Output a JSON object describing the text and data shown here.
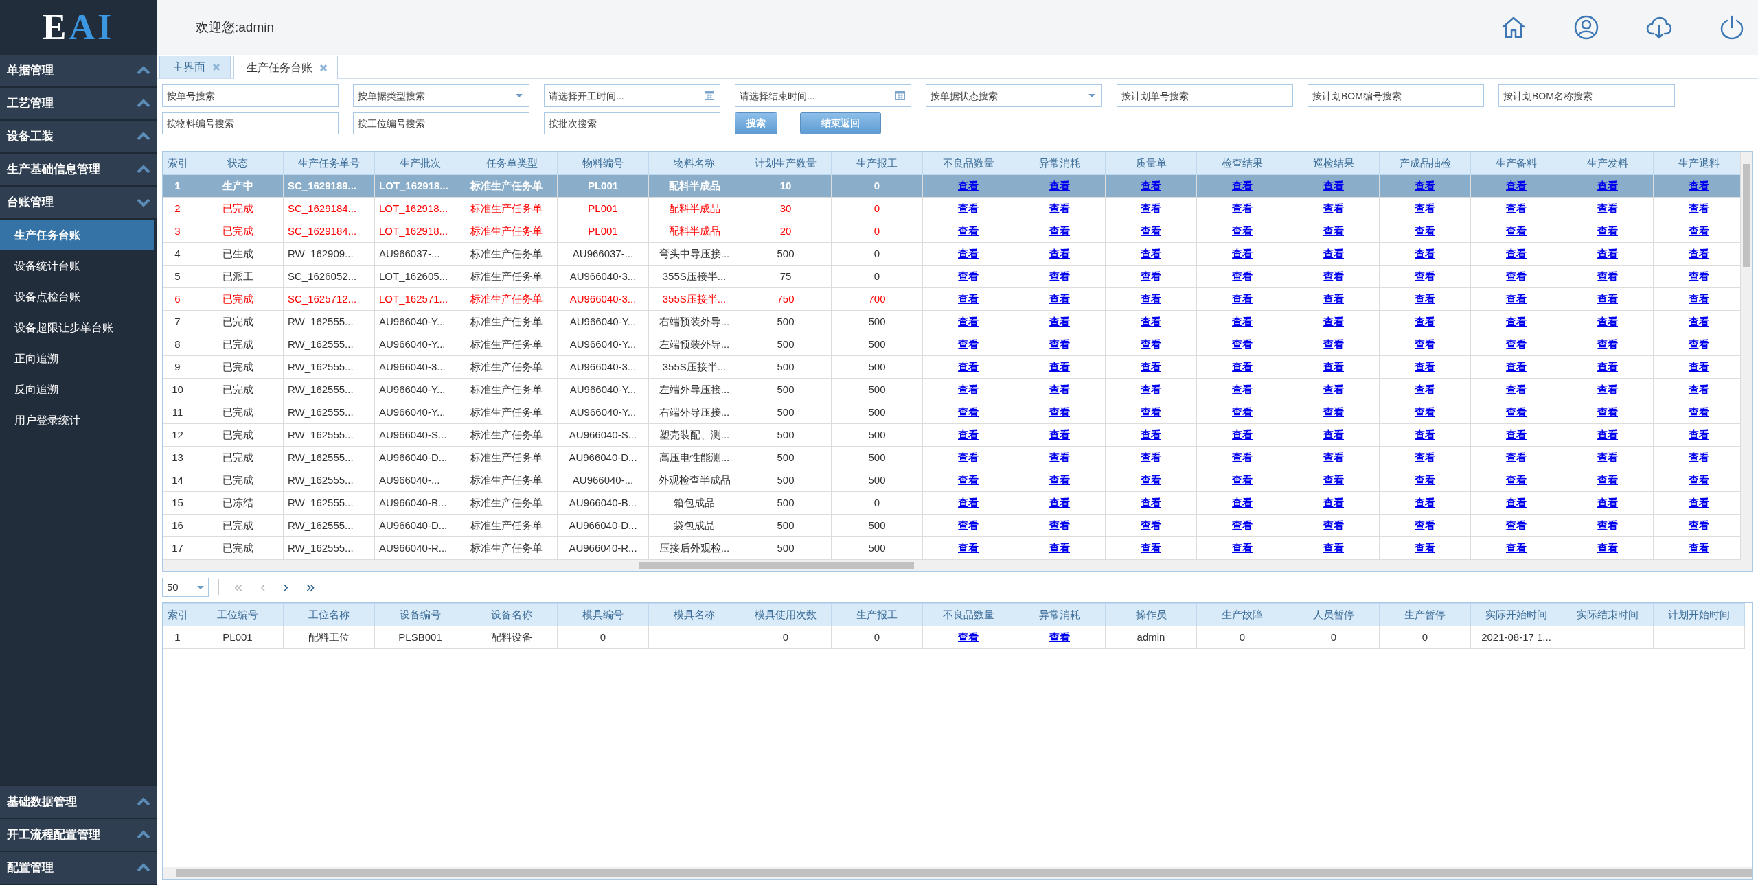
{
  "sidebar": {
    "logo": [
      {
        "text": "E",
        "color": "#ffffff"
      },
      {
        "text": "AI",
        "color": "#3c97e0"
      }
    ],
    "groups": [
      {
        "label": "单据管理",
        "expanded": false
      },
      {
        "label": "工艺管理",
        "expanded": false
      },
      {
        "label": "设备工装",
        "expanded": false
      },
      {
        "label": "生产基础信息管理",
        "expanded": false
      },
      {
        "label": "台账管理",
        "expanded": true,
        "children": [
          {
            "label": "生产任务台账",
            "selected": true
          },
          {
            "label": "设备统计台账",
            "selected": false
          },
          {
            "label": "设备点检台账",
            "selected": false
          },
          {
            "label": "设备超限让步单台账",
            "selected": false
          },
          {
            "label": "正向追溯",
            "selected": false
          },
          {
            "label": "反向追溯",
            "selected": false
          },
          {
            "label": "用户登录统计",
            "selected": false
          }
        ]
      }
    ],
    "bottom_groups": [
      {
        "label": "基础数据管理",
        "expanded": false
      },
      {
        "label": "开工流程配置管理",
        "expanded": false
      },
      {
        "label": "配置管理",
        "expanded": false
      }
    ]
  },
  "header": {
    "welcome": "欢迎您:admin"
  },
  "tabs": [
    {
      "label": "主界面",
      "selected": false
    },
    {
      "label": "生产任务台账",
      "selected": true
    }
  ],
  "filters": [
    [
      {
        "kind": "text",
        "placeholder": "按单号搜索"
      },
      {
        "kind": "select",
        "placeholder": "按单据类型搜索"
      },
      {
        "kind": "date",
        "placeholder": "请选择开工时间..."
      },
      {
        "kind": "date",
        "placeholder": "请选择结束时间..."
      },
      {
        "kind": "select",
        "placeholder": "按单据状态搜索"
      },
      {
        "kind": "text",
        "placeholder": "按计划单号搜索"
      },
      {
        "kind": "text",
        "placeholder": "按计划BOM编号搜索"
      },
      {
        "kind": "text",
        "placeholder": "按计划BOM名称搜索"
      }
    ],
    [
      {
        "kind": "text",
        "placeholder": "按物料编号搜索"
      },
      {
        "kind": "text",
        "placeholder": "按工位编号搜索"
      },
      {
        "kind": "text",
        "placeholder": "按批次搜索"
      }
    ]
  ],
  "filter_buttons": [
    "搜索",
    "结束返回"
  ],
  "task_table": {
    "columns": [
      "索引",
      "状态",
      "生产任务单号",
      "生产批次",
      "任务单类型",
      "物料编号",
      "物料名称",
      "计划生产数量",
      "生产报工",
      "不良品数量",
      "异常消耗",
      "质量单",
      "检查结果",
      "巡检结果",
      "产成品抽检",
      "生产备料",
      "生产发料",
      "生产退料"
    ],
    "rows": [
      {
        "selected": true,
        "warning": false,
        "cells": [
          "1",
          "生产中",
          "SC_1629189...",
          "LOT_162918...",
          "标准生产任务单",
          "PL001",
          "配料半成品",
          "10",
          "0"
        ],
        "links": [
          "查看",
          "查看",
          "查看",
          "查看",
          "查看",
          "查看",
          "查看",
          "查看",
          "查看"
        ]
      },
      {
        "selected": false,
        "warning": true,
        "cells": [
          "2",
          "已完成",
          "SC_1629184...",
          "LOT_162918...",
          "标准生产任务单",
          "PL001",
          "配料半成品",
          "30",
          "0"
        ],
        "links": [
          "查看",
          "查看",
          "查看",
          "查看",
          "查看",
          "查看",
          "查看",
          "查看",
          "查看"
        ]
      },
      {
        "selected": false,
        "warning": true,
        "cells": [
          "3",
          "已完成",
          "SC_1629184...",
          "LOT_162918...",
          "标准生产任务单",
          "PL001",
          "配料半成品",
          "20",
          "0"
        ],
        "links": [
          "查看",
          "查看",
          "查看",
          "查看",
          "查看",
          "查看",
          "查看",
          "查看",
          "查看"
        ]
      },
      {
        "selected": false,
        "warning": false,
        "cells": [
          "4",
          "已生成",
          "RW_162909...",
          "AU966037-...",
          "标准生产任务单",
          "AU966037-...",
          "弯头中导压接...",
          "500",
          "0"
        ],
        "links": [
          "查看",
          "查看",
          "查看",
          "查看",
          "查看",
          "查看",
          "查看",
          "查看",
          "查看"
        ]
      },
      {
        "selected": false,
        "warning": false,
        "cells": [
          "5",
          "已派工",
          "SC_1626052...",
          "LOT_162605...",
          "标准生产任务单",
          "AU966040-3...",
          "355S压接半...",
          "75",
          "0"
        ],
        "links": [
          "查看",
          "查看",
          "查看",
          "查看",
          "查看",
          "查看",
          "查看",
          "查看",
          "查看"
        ]
      },
      {
        "selected": false,
        "warning": true,
        "cells": [
          "6",
          "已完成",
          "SC_1625712...",
          "LOT_162571...",
          "标准生产任务单",
          "AU966040-3...",
          "355S压接半...",
          "750",
          "700"
        ],
        "links": [
          "查看",
          "查看",
          "查看",
          "查看",
          "查看",
          "查看",
          "查看",
          "查看",
          "查看"
        ]
      },
      {
        "selected": false,
        "warning": false,
        "cells": [
          "7",
          "已完成",
          "RW_162555...",
          "AU966040-Y...",
          "标准生产任务单",
          "AU966040-Y...",
          "右端预装外导...",
          "500",
          "500"
        ],
        "links": [
          "查看",
          "查看",
          "查看",
          "查看",
          "查看",
          "查看",
          "查看",
          "查看",
          "查看"
        ]
      },
      {
        "selected": false,
        "warning": false,
        "cells": [
          "8",
          "已完成",
          "RW_162555...",
          "AU966040-Y...",
          "标准生产任务单",
          "AU966040-Y...",
          "左端预装外导...",
          "500",
          "500"
        ],
        "links": [
          "查看",
          "查看",
          "查看",
          "查看",
          "查看",
          "查看",
          "查看",
          "查看",
          "查看"
        ]
      },
      {
        "selected": false,
        "warning": false,
        "cells": [
          "9",
          "已完成",
          "RW_162555...",
          "AU966040-3...",
          "标准生产任务单",
          "AU966040-3...",
          "355S压接半...",
          "500",
          "500"
        ],
        "links": [
          "查看",
          "查看",
          "查看",
          "查看",
          "查看",
          "查看",
          "查看",
          "查看",
          "查看"
        ]
      },
      {
        "selected": false,
        "warning": false,
        "cells": [
          "10",
          "已完成",
          "RW_162555...",
          "AU966040-Y...",
          "标准生产任务单",
          "AU966040-Y...",
          "左端外导压接...",
          "500",
          "500"
        ],
        "links": [
          "查看",
          "查看",
          "查看",
          "查看",
          "查看",
          "查看",
          "查看",
          "查看",
          "查看"
        ]
      },
      {
        "selected": false,
        "warning": false,
        "cells": [
          "11",
          "已完成",
          "RW_162555...",
          "AU966040-Y...",
          "标准生产任务单",
          "AU966040-Y...",
          "右端外导压接...",
          "500",
          "500"
        ],
        "links": [
          "查看",
          "查看",
          "查看",
          "查看",
          "查看",
          "查看",
          "查看",
          "查看",
          "查看"
        ]
      },
      {
        "selected": false,
        "warning": false,
        "cells": [
          "12",
          "已完成",
          "RW_162555...",
          "AU966040-S...",
          "标准生产任务单",
          "AU966040-S...",
          "塑壳装配、测...",
          "500",
          "500"
        ],
        "links": [
          "查看",
          "查看",
          "查看",
          "查看",
          "查看",
          "查看",
          "查看",
          "查看",
          "查看"
        ]
      },
      {
        "selected": false,
        "warning": false,
        "cells": [
          "13",
          "已完成",
          "RW_162555...",
          "AU966040-D...",
          "标准生产任务单",
          "AU966040-D...",
          "高压电性能测...",
          "500",
          "500"
        ],
        "links": [
          "查看",
          "查看",
          "查看",
          "查看",
          "查看",
          "查看",
          "查看",
          "查看",
          "查看"
        ]
      },
      {
        "selected": false,
        "warning": false,
        "cells": [
          "14",
          "已完成",
          "RW_162555...",
          "AU966040-...",
          "标准生产任务单",
          "AU966040-...",
          "外观检查半成品",
          "500",
          "500"
        ],
        "links": [
          "查看",
          "查看",
          "查看",
          "查看",
          "查看",
          "查看",
          "查看",
          "查看",
          "查看"
        ]
      },
      {
        "selected": false,
        "warning": false,
        "cells": [
          "15",
          "已冻结",
          "RW_162555...",
          "AU966040-B...",
          "标准生产任务单",
          "AU966040-B...",
          "箱包成品",
          "500",
          "0"
        ],
        "links": [
          "查看",
          "查看",
          "查看",
          "查看",
          "查看",
          "查看",
          "查看",
          "查看",
          "查看"
        ]
      },
      {
        "selected": false,
        "warning": false,
        "cells": [
          "16",
          "已完成",
          "RW_162555...",
          "AU966040-D...",
          "标准生产任务单",
          "AU966040-D...",
          "袋包成品",
          "500",
          "500"
        ],
        "links": [
          "查看",
          "查看",
          "查看",
          "查看",
          "查看",
          "查看",
          "查看",
          "查看",
          "查看"
        ]
      },
      {
        "selected": false,
        "warning": false,
        "cells": [
          "17",
          "已完成",
          "RW_162555...",
          "AU966040-R...",
          "标准生产任务单",
          "AU966040-R...",
          "压接后外观检...",
          "500",
          "500"
        ],
        "links": [
          "查看",
          "查看",
          "查看",
          "查看",
          "查看",
          "查看",
          "查看",
          "查看",
          "查看"
        ]
      }
    ]
  },
  "pager": {
    "page_size": "50",
    "buttons": [
      {
        "label": "«",
        "disabled": true
      },
      {
        "label": "‹",
        "disabled": true
      },
      {
        "label": "›",
        "disabled": false
      },
      {
        "label": "»",
        "disabled": false
      }
    ]
  },
  "detail_table": {
    "columns": [
      "索引",
      "工位编号",
      "工位名称",
      "设备编号",
      "设备名称",
      "模具编号",
      "模具名称",
      "模具使用次数",
      "生产报工",
      "不良品数量",
      "异常消耗",
      "操作员",
      "生产故障",
      "人员暂停",
      "生产暂停",
      "实际开始时间",
      "实际结束时间",
      "计划开始时间"
    ],
    "rows": [
      {
        "cells": [
          {
            "kind": "text",
            "text": "1"
          },
          {
            "kind": "text",
            "text": "PL001"
          },
          {
            "kind": "text",
            "text": "配料工位"
          },
          {
            "kind": "text",
            "text": "PLSB001"
          },
          {
            "kind": "text",
            "text": "配料设备"
          },
          {
            "kind": "text",
            "text": "0"
          },
          {
            "kind": "empty"
          },
          {
            "kind": "text",
            "text": "0"
          },
          {
            "kind": "text",
            "text": "0"
          },
          {
            "kind": "link",
            "text": "查看"
          },
          {
            "kind": "link",
            "text": "查看"
          },
          {
            "kind": "text",
            "text": "admin"
          },
          {
            "kind": "text",
            "text": "0"
          },
          {
            "kind": "text",
            "text": "0"
          },
          {
            "kind": "text",
            "text": "0"
          },
          {
            "kind": "text",
            "text": "2021-08-17 1..."
          },
          {
            "kind": "empty"
          },
          {
            "kind": "empty"
          }
        ]
      }
    ]
  }
}
